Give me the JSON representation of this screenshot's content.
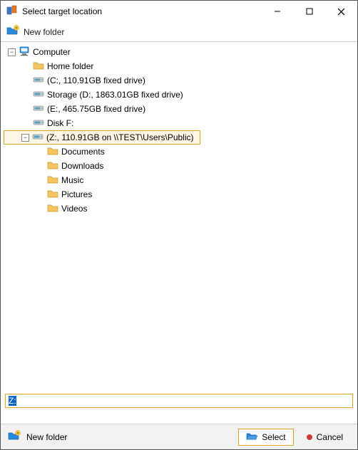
{
  "window": {
    "title": "Select target location"
  },
  "toolbar": {
    "new_folder": "New folder"
  },
  "tree": {
    "computer": "Computer",
    "home_folder": "Home folder",
    "drive_c": "(C:, 110.91GB fixed drive)",
    "drive_d": "Storage (D:, 1863.01GB fixed drive)",
    "drive_e": "(E:, 465.75GB fixed drive)",
    "disk_f": "Disk F:",
    "drive_z": "(Z:, 110.91GB on \\\\TEST\\Users\\Public)",
    "documents": "Documents",
    "downloads": "Downloads",
    "music": "Music",
    "pictures": "Pictures",
    "videos": "Videos"
  },
  "path": {
    "value": "Z:"
  },
  "footer": {
    "new_folder": "New folder",
    "select": "Select",
    "cancel": "Cancel"
  }
}
